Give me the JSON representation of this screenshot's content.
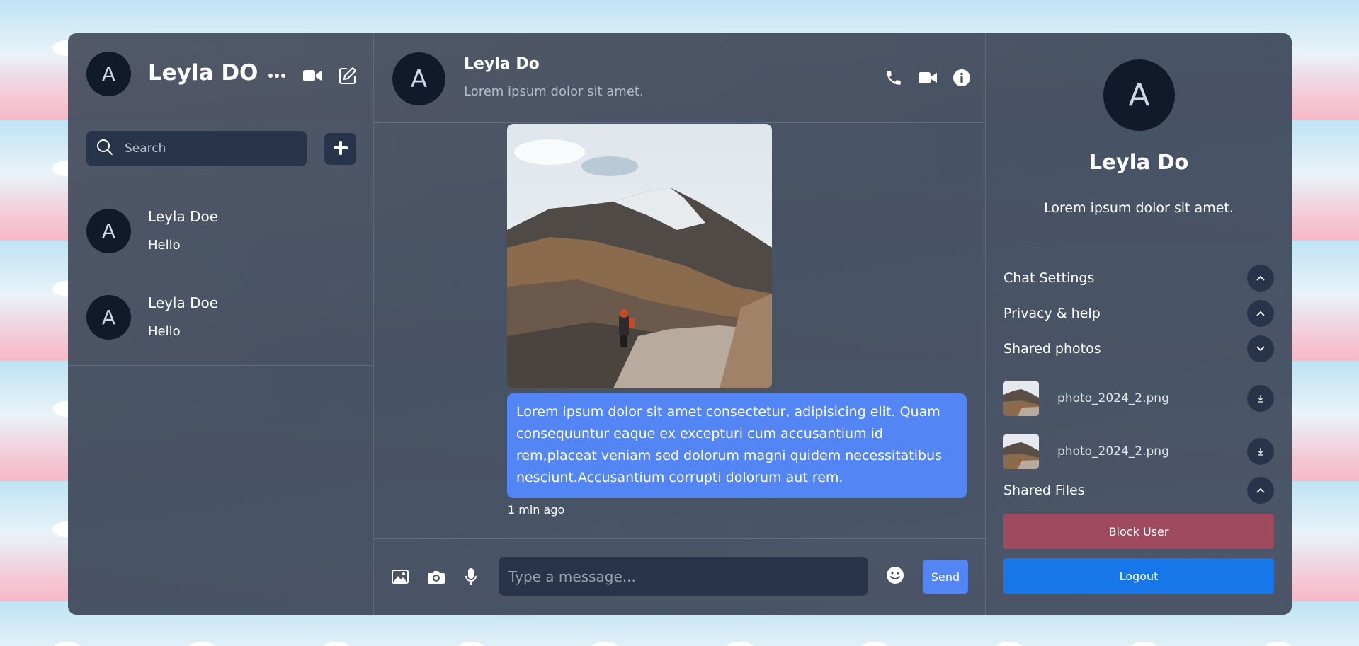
{
  "current_user": {
    "avatar_letter": "A",
    "name": "Leyla DO"
  },
  "header_icons": [
    "more-dots-icon",
    "video-camera-icon",
    "compose-icon"
  ],
  "search": {
    "placeholder": "Search"
  },
  "chats": [
    {
      "avatar_letter": "A",
      "name": "Leyla Doe",
      "last_message": "Hello"
    },
    {
      "avatar_letter": "A",
      "name": "Leyla Doe",
      "last_message": "Hello"
    }
  ],
  "active_chat": {
    "avatar_letter": "A",
    "name": "Leyla Do",
    "status": "Lorem ipsum dolor sit amet."
  },
  "message": {
    "text": "Lorem ipsum dolor sit amet consectetur, adipisicing elit. Quam consequuntur eaque ex excepturi cum accusantium id rem,placeat veniam sed dolorum magni quidem necessitatibus nesciunt.Accusantium corrupti dolorum aut rem.",
    "time": "1 min ago"
  },
  "composer": {
    "placeholder": "Type a message...",
    "send_label": "Send"
  },
  "details": {
    "avatar_letter": "A",
    "name": "Leyla Do",
    "description": "Lorem ipsum dolor sit amet.",
    "sections": {
      "chat_settings": "Chat Settings",
      "privacy": "Privacy & help",
      "shared_photos": "Shared photos",
      "shared_files": "Shared Files"
    },
    "photos": [
      {
        "filename": "photo_2024_2.png"
      },
      {
        "filename": "photo_2024_2.png"
      }
    ],
    "block_label": "Block User",
    "logout_label": "Logout"
  },
  "colors": {
    "accent": "#5386f4",
    "block": "#a04a60",
    "logout": "#1877e8",
    "field": "#27344a",
    "avatar": "#111a2b"
  }
}
